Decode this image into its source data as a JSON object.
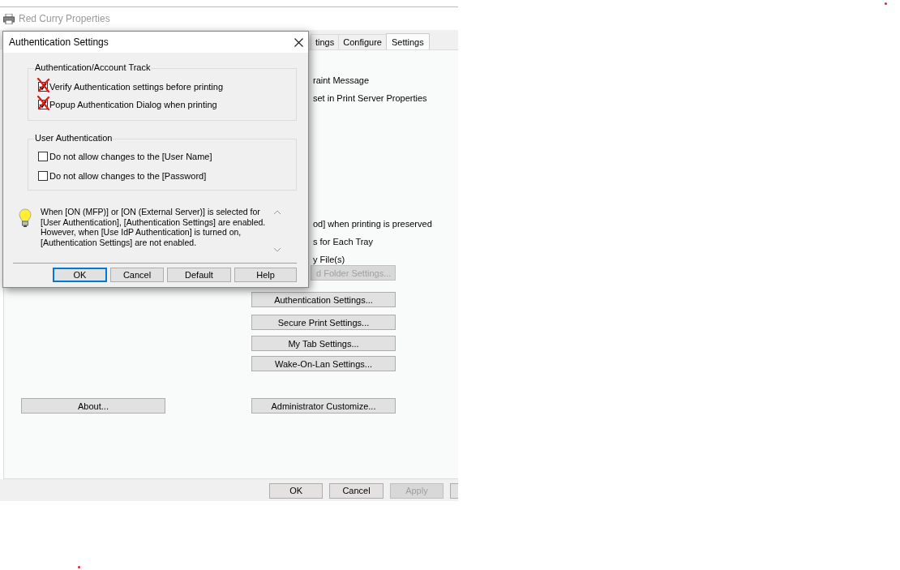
{
  "window": {
    "title": "Red Curry Properties"
  },
  "tabs": [
    {
      "label": "tings",
      "selected": false
    },
    {
      "label": "Configure",
      "selected": false
    },
    {
      "label": "Settings",
      "selected": true
    }
  ],
  "options_top": [
    "raint Message",
    "set in Print Server Properties"
  ],
  "options_bottom": [
    "od] when printing is preserved",
    "s for Each Tray",
    "y File(s)"
  ],
  "settings_buttons": [
    {
      "label": "d Folder Settings...",
      "disabled": true
    },
    {
      "label": "Authentication Settings...",
      "disabled": false
    },
    {
      "label": "Secure Print Settings...",
      "disabled": false
    },
    {
      "label": "My Tab Settings...",
      "disabled": false
    },
    {
      "label": "Wake-On-Lan Settings...",
      "disabled": false
    }
  ],
  "about_button": "About...",
  "admin_button": "Administrator Customize...",
  "footer_buttons": [
    {
      "label": "OK",
      "disabled": false
    },
    {
      "label": "Cancel",
      "disabled": false
    },
    {
      "label": "Apply",
      "disabled": true
    }
  ],
  "dialog": {
    "title": "Authentication Settings",
    "groups": [
      {
        "title": "Authentication/Account Track",
        "options": [
          {
            "label": "Verify Authentication settings before printing",
            "checked": true,
            "marked": true
          },
          {
            "label": "Popup Authentication Dialog when printing",
            "checked": true,
            "marked": true
          }
        ]
      },
      {
        "title": "User Authentication",
        "options": [
          {
            "label": "Do not allow changes to the [User Name]",
            "checked": false,
            "marked": false
          },
          {
            "label": "Do not allow changes to the [Password]",
            "checked": false,
            "marked": false
          }
        ]
      }
    ],
    "note": "When [ON (MFP)] or [ON (External Server)] is selected for [User Authentication], [Authentication Settings] are enabled. However, when [Use IdP Authentication] is turned on, [Authentication Settings] are not enabled.",
    "buttons": [
      {
        "label": "OK",
        "focused": true
      },
      {
        "label": "Cancel",
        "focused": false
      },
      {
        "label": "Default",
        "focused": false
      },
      {
        "label": "Help",
        "focused": false
      }
    ]
  }
}
